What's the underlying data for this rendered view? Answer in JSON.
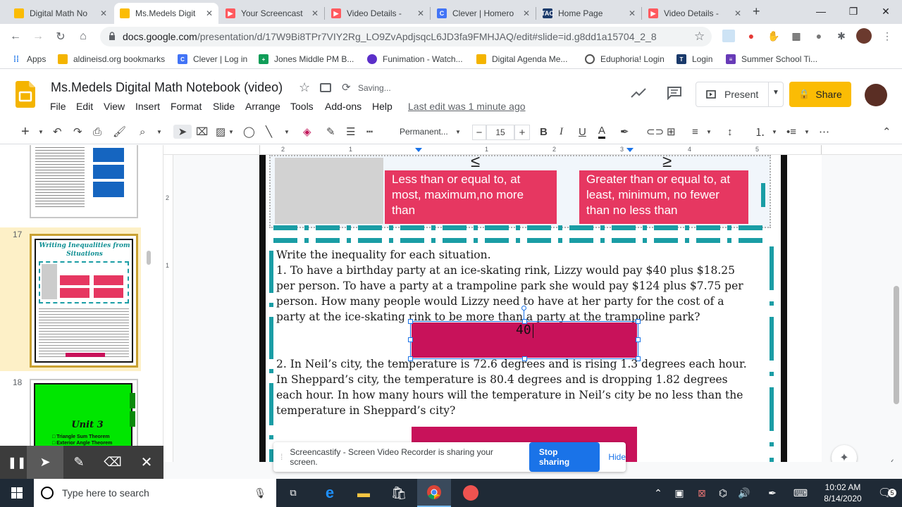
{
  "browser": {
    "tabs": [
      {
        "title": "Digital Math No",
        "icon": "slides-icon",
        "color": "#fbbc04"
      },
      {
        "title": "Ms.Medels Digit",
        "icon": "slides-icon",
        "color": "#fbbc04"
      },
      {
        "title": "Your Screencast",
        "icon": "screencastify-icon",
        "color": "#ff5a5f"
      },
      {
        "title": "Video Details -",
        "icon": "screencastify-icon",
        "color": "#ff5a5f"
      },
      {
        "title": "Clever | Homero",
        "icon": "clever-icon",
        "color": "#4274f6"
      },
      {
        "title": "Home Page",
        "icon": "tac-icon",
        "color": "#1a3a6b"
      },
      {
        "title": "Video Details -",
        "icon": "screencastify-icon",
        "color": "#ff5a5f"
      }
    ],
    "new_tab": "+",
    "url_host": "docs.google.com",
    "url_path": "/presentation/d/17W9Bi8TPr7VIY2Rg_LO9ZvApdjsqcL6JD3fa9FMHJAQ/edit#slide=id.g8dd1a15704_2_8",
    "bookmarks": [
      {
        "label": "Apps",
        "icon": "apps-grid-icon"
      },
      {
        "label": "aldineisd.org bookmarks",
        "icon": "folder-icon"
      },
      {
        "label": "Clever | Log in",
        "icon": "clever-icon"
      },
      {
        "label": "Jones Middle PM B...",
        "icon": "jones-icon"
      },
      {
        "label": "Funimation - Watch...",
        "icon": "funimation-icon"
      },
      {
        "label": "Digital Agenda Me...",
        "icon": "folder-icon"
      },
      {
        "label": "Eduphoria! Login",
        "icon": "eduphoria-icon"
      },
      {
        "label": "Login",
        "icon": "tac-icon"
      },
      {
        "label": "Summer School Ti...",
        "icon": "forms-icon"
      }
    ]
  },
  "slides_app": {
    "doc_title": "Ms.Medels Digital Math Notebook (video)",
    "saving": "Saving...",
    "menus": [
      "File",
      "Edit",
      "View",
      "Insert",
      "Format",
      "Slide",
      "Arrange",
      "Tools",
      "Add-ons",
      "Help"
    ],
    "last_edit": "Last edit was 1 minute ago",
    "present_label": "Present",
    "share_label": "Share",
    "font_name": "Permanent...",
    "font_size": "15",
    "accent": "#fbbc04"
  },
  "filmstrip": {
    "slide17_number": "17",
    "slide18_number": "18",
    "slide17_title": "Writing Inequalities from Situations",
    "slide18_title": "Unit 3",
    "slide18_items": [
      "Triangle Sum Theorem",
      "Exterior Angle Theorem"
    ]
  },
  "ruler": {
    "h_labels": [
      "2",
      "1",
      "1",
      "2",
      "3",
      "4",
      "5"
    ],
    "v_labels": [
      "2",
      "1"
    ]
  },
  "slide": {
    "le_symbol": "≤",
    "ge_symbol": "≥",
    "le_text": "Less than or equal to, at most, maximum,no more than",
    "ge_text": "Greater than or equal to, at least, minimum, no fewer than no less than",
    "instructions": "Write the inequality for each situation.",
    "q1_lines": [
      "1. To have a birthday party at an ice-skating rink, Lizzy would pay $40 plus $18.25",
      "per person. To have a party at a trampoline park she would pay $124 plus $7.75 per",
      "person. How many people would Lizzy need to have at her party for the cost of a",
      "party at the ice-skating rink to be more than a party at the trampoline park?"
    ],
    "answer1_text": "40",
    "q2_lines": [
      "2.  In Neil’s city, the temperature is 72.6 degrees and is rising 1.3 degrees each hour.",
      "In Sheppard’s city, the temperature is 80.4 degrees and is dropping 1.82 degrees",
      "each hour. In how many hours will the temperature in Neil’s city be no less than the",
      "temperature in Sheppard’s city?"
    ],
    "colors": {
      "teal": "#1a9da5",
      "pink": "#e63761",
      "answer": "#c8125a"
    }
  },
  "screencastify": {
    "message": "Screencastify - Screen Video Recorder is sharing your screen.",
    "stop_label": "Stop sharing",
    "hide_label": "Hide"
  },
  "taskbar": {
    "search_placeholder": "Type here to search",
    "time": "10:02 AM",
    "date": "8/14/2020",
    "notifications": "5"
  }
}
